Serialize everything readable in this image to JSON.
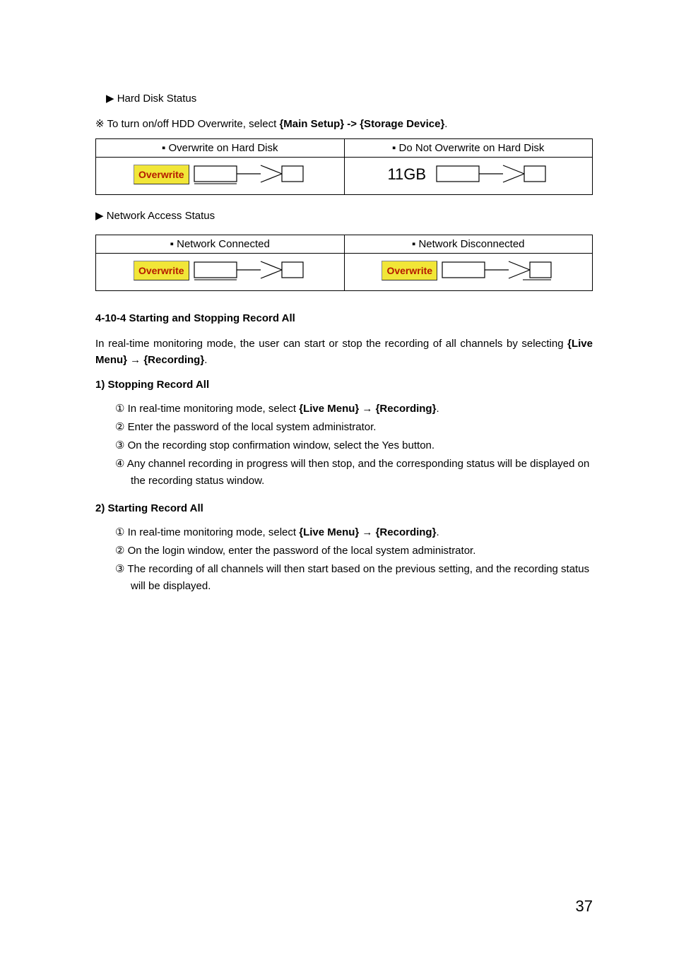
{
  "hard_disk": {
    "heading": "▶ Hard Disk Status",
    "note_prefix": "※ To turn on/off HDD Overwrite, select ",
    "note_bold": "{Main Setup} -> {Storage Device}",
    "note_suffix": ".",
    "headers": {
      "left": "▪ Overwrite on Hard Disk",
      "right": "▪ Do Not Overwrite on Hard Disk"
    },
    "labels": {
      "overwrite": "Overwrite",
      "size": "11GB"
    }
  },
  "network": {
    "heading": "▶ Network Access Status",
    "headers": {
      "left": "▪ Network Connected",
      "right": "▪ Network Disconnected"
    },
    "labels": {
      "overwrite_left": "Overwrite",
      "overwrite_right": "Overwrite"
    }
  },
  "section410_4": {
    "heading": "4-10-4  Starting and Stopping Record All",
    "para_prefix": "In real-time monitoring mode, the user can start or stop the recording of all channels by selecting ",
    "para_bold": "{Live Menu} → {Recording}",
    "para_suffix": "."
  },
  "stop": {
    "heading": "1)  Stopping Record All",
    "steps": [
      {
        "n": "①",
        "pre": " In real-time monitoring mode, select ",
        "bold": "{Live Menu} → {Recording}",
        "post": "."
      },
      {
        "n": "②",
        "pre": " Enter the password of the local system administrator.",
        "bold": "",
        "post": ""
      },
      {
        "n": "③",
        "pre": " On the recording stop confirmation window, select the Yes button.",
        "bold": "",
        "post": ""
      },
      {
        "n": "④",
        "pre": " Any channel recording in progress will then stop, and the corresponding status will be displayed on the recording status window.",
        "bold": "",
        "post": ""
      }
    ]
  },
  "start": {
    "heading": "2)  Starting Record All",
    "steps": [
      {
        "n": "①",
        "pre": " In real-time monitoring mode, select ",
        "bold": "{Live Menu} → {Recording}",
        "post": "."
      },
      {
        "n": "②",
        "pre": " On the login window, enter the password of the local system administrator.",
        "bold": "",
        "post": ""
      },
      {
        "n": "③",
        "pre": " The recording of all channels will then start based on the previous setting, and the recording status will be displayed.",
        "bold": "",
        "post": ""
      }
    ]
  },
  "page_number": "37"
}
